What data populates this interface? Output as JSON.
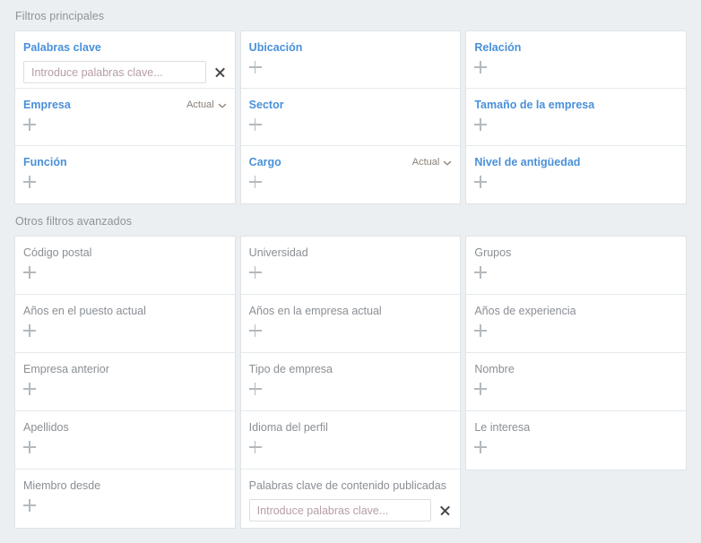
{
  "theme": {
    "page_background": "#eceff1",
    "card_background": "#ffffff",
    "card_border": "#dfe3e6",
    "primary_label_color": "#4a90d9",
    "secondary_label_color": "#8a8f94",
    "section_header_color": "#8d9397",
    "scope_color": "#8a7f74",
    "plus_icon_color": "#b4b9bd",
    "placeholder_color": "#b79ea6"
  },
  "sections": [
    {
      "id": "primary",
      "header": "Filtros principales",
      "columns": [
        {
          "cells": [
            {
              "label": "Palabras clave",
              "control": "input",
              "input": {
                "value": "",
                "placeholder": "Introduce palabras clave..."
              },
              "clear_icon": "close-icon"
            },
            {
              "label": "Empresa",
              "control": "plus",
              "scope": {
                "label": "Actual",
                "icon": "chevron-down-icon"
              }
            },
            {
              "label": "Función",
              "control": "plus"
            }
          ]
        },
        {
          "cells": [
            {
              "label": "Ubicación",
              "control": "plus"
            },
            {
              "label": "Sector",
              "control": "plus"
            },
            {
              "label": "Cargo",
              "control": "plus",
              "scope": {
                "label": "Actual",
                "icon": "chevron-down-icon"
              }
            }
          ]
        },
        {
          "cells": [
            {
              "label": "Relación",
              "control": "plus"
            },
            {
              "label": "Tamaño de la empresa",
              "control": "plus"
            },
            {
              "label": "Nivel de antigüedad",
              "control": "plus"
            }
          ]
        }
      ]
    },
    {
      "id": "advanced",
      "header": "Otros filtros avanzados",
      "columns": [
        {
          "cells": [
            {
              "label": "Código postal",
              "control": "plus"
            },
            {
              "label": "Años en el puesto actual",
              "control": "plus"
            },
            {
              "label": "Empresa anterior",
              "control": "plus"
            },
            {
              "label": "Apellidos",
              "control": "plus"
            },
            {
              "label": "Miembro desde",
              "control": "plus"
            }
          ]
        },
        {
          "cells": [
            {
              "label": "Universidad",
              "control": "plus"
            },
            {
              "label": "Años en la empresa actual",
              "control": "plus"
            },
            {
              "label": "Tipo de empresa",
              "control": "plus"
            },
            {
              "label": "Idioma del perfil",
              "control": "plus"
            },
            {
              "label": "Palabras clave de contenido publicadas",
              "control": "input",
              "input": {
                "value": "",
                "placeholder": "Introduce palabras clave..."
              },
              "clear_icon": "close-icon"
            }
          ]
        },
        {
          "cells": [
            {
              "label": "Grupos",
              "control": "plus"
            },
            {
              "label": "Años de experiencia",
              "control": "plus"
            },
            {
              "label": "Nombre",
              "control": "plus"
            },
            {
              "label": "Le interesa",
              "control": "plus"
            }
          ]
        }
      ]
    }
  ]
}
